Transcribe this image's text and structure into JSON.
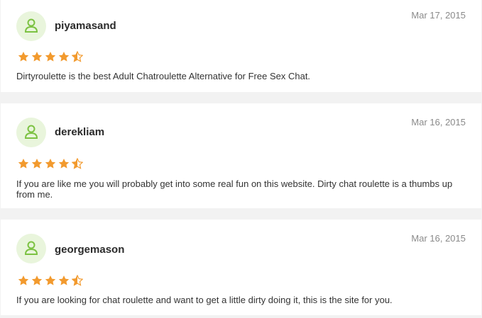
{
  "colors": {
    "star": "#f29a2e",
    "avatar_bg": "#e9f5dc",
    "avatar_icon": "#7cc242"
  },
  "reviews": [
    {
      "username": "piyamasand",
      "date": "Mar 17, 2015",
      "rating": 4.5,
      "text": "Dirtyroulette is the best Adult Chatroulette Alternative for Free Sex Chat."
    },
    {
      "username": "derekliam",
      "date": "Mar 16, 2015",
      "rating": 4.5,
      "text": "If you are like me you will probably get into some real fun on this website. Dirty chat roulette is a thumbs up from me."
    },
    {
      "username": "georgemason",
      "date": "Mar 16, 2015",
      "rating": 4.5,
      "text": "If you are looking for chat roulette and want to get a little dirty doing it, this is the site for you."
    }
  ]
}
